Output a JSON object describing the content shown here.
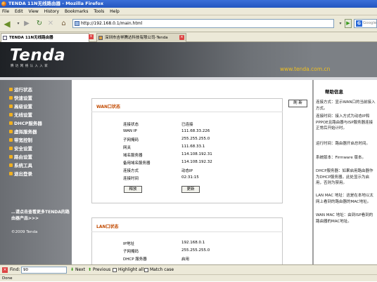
{
  "window": {
    "title": "TENDA 11N无线路由器 - Mozilla Firefox"
  },
  "menu": [
    "File",
    "Edit",
    "View",
    "History",
    "Bookmarks",
    "Tools",
    "Help"
  ],
  "nav": {
    "url": "http://192.168.0.1/main.html",
    "search_placeholder": "Google"
  },
  "tabs": [
    {
      "label": "TENDA 11N无线路由器"
    },
    {
      "label": "深圳市吉祥腾达科技有限公司-Tenda"
    }
  ],
  "banner": {
    "logo": "Tenda",
    "logo_sub": "腾达网络认入入家",
    "site": "www.tenda.com.cn"
  },
  "sidebar": {
    "items": [
      "运行状态",
      "快速设置",
      "高级设置",
      "无线设置",
      "DHCP服务器",
      "虚拟服务器",
      "带宽控制",
      "安全设置",
      "路由设置",
      "系统工具",
      "退出登录"
    ],
    "promo": "…请点击查看更多TENDA的路由器产品>>>",
    "copyright": "©2009 Tenda"
  },
  "wan": {
    "title": "WAN口状态",
    "rows": [
      {
        "label": "连接状态",
        "value": "已连接"
      },
      {
        "label": "WAN IP",
        "value": "111.68.33.226"
      },
      {
        "label": "子网掩码",
        "value": "255.255.255.0"
      },
      {
        "label": "网关",
        "value": "111.68.33.1"
      },
      {
        "label": "域名服务器",
        "value": "114.108.192.31"
      },
      {
        "label": "备用域名服务器",
        "value": "114.108.192.32"
      },
      {
        "label": "连接方式",
        "value": "动态IP"
      },
      {
        "label": "连接时间",
        "value": "02:31:15"
      }
    ],
    "release_label": "释放",
    "renew_label": "更新"
  },
  "lan": {
    "title": "LAN口状态",
    "rows": [
      {
        "label": "IP地址",
        "value": "192.168.0.1"
      },
      {
        "label": "子网掩码",
        "value": "255.255.255.0"
      },
      {
        "label": "DHCP 服务器",
        "value": "启用"
      }
    ]
  },
  "refresh_label": "刷 新",
  "help": {
    "title": "帮助信息",
    "paragraphs": [
      "连接方式：显示WAN口的当前接入方式。",
      "连接时间：接入方式为动态IP和PPPOE且路由器与ISP服务器连接正常后开始计时。",
      "运行时间：路由器开启总时间。",
      "系统版本：Firmware 版本。",
      "DHCP服务器：如果启用路由器作为DHCP服务器，此处显示为启用，否则为禁用。",
      "LAN MAC 地址：这是在本地以太网上看到的路由器的MAC地址。",
      "WAN MAC 地址：由到ISP看到的路由器的MAC地址。"
    ]
  },
  "find": {
    "label": "Find:",
    "value": "90",
    "next": "Next",
    "previous": "Previous",
    "highlight": "Highlight all",
    "match_case": "Match case"
  },
  "status": "Done"
}
